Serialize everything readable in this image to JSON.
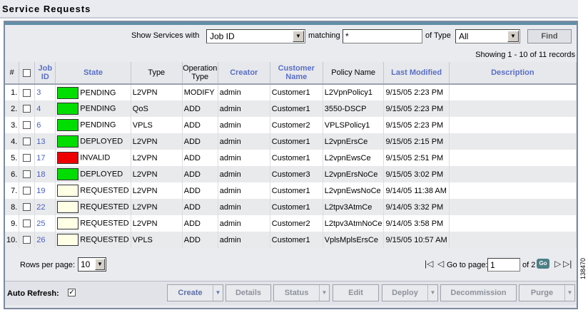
{
  "page": {
    "title": "Service Requests",
    "figure_id": "138470"
  },
  "filter": {
    "show_label": "Show Services with",
    "field_value": "Job ID",
    "matching_label": "matching",
    "matching_value": "*",
    "type_label": "of Type",
    "type_value": "All",
    "find_label": "Find"
  },
  "showing_text": "Showing 1 - 10 of 11 records",
  "table": {
    "headers": {
      "num": "#",
      "job_id": "Job ID",
      "state": "State",
      "type": "Type",
      "op_type": "Operation Type",
      "creator": "Creator",
      "customer": "Customer Name",
      "policy": "Policy Name",
      "last_modified": "Last Modified",
      "description": "Description"
    },
    "rows": [
      {
        "num": "1.",
        "job_id": "3",
        "state_color": "#00dd00",
        "state": "PENDING",
        "type": "L2VPN",
        "op_type": "MODIFY",
        "creator": "admin",
        "customer": "Customer1",
        "policy": "L2VpnPolicy1",
        "last_modified": "9/15/05 2:23 PM",
        "description": ""
      },
      {
        "num": "2.",
        "job_id": "4",
        "state_color": "#00dd00",
        "state": "PENDING",
        "type": "QoS",
        "op_type": "ADD",
        "creator": "admin",
        "customer": "Customer1",
        "policy": "3550-DSCP",
        "last_modified": "9/15/05 2:23 PM",
        "description": ""
      },
      {
        "num": "3.",
        "job_id": "6",
        "state_color": "#00dd00",
        "state": "PENDING",
        "type": "VPLS",
        "op_type": "ADD",
        "creator": "admin",
        "customer": "Customer2",
        "policy": "VPLSPolicy1",
        "last_modified": "9/15/05 2:23 PM",
        "description": ""
      },
      {
        "num": "4.",
        "job_id": "13",
        "state_color": "#00dd00",
        "state": "DEPLOYED",
        "type": "L2VPN",
        "op_type": "ADD",
        "creator": "admin",
        "customer": "Customer1",
        "policy": "L2vpnErsCe",
        "last_modified": "9/15/05 2:15 PM",
        "description": ""
      },
      {
        "num": "5.",
        "job_id": "17",
        "state_color": "#ee0000",
        "state": "INVALID",
        "type": "L2VPN",
        "op_type": "ADD",
        "creator": "admin",
        "customer": "Customer1",
        "policy": "L2vpnEwsCe",
        "last_modified": "9/15/05 2:51 PM",
        "description": ""
      },
      {
        "num": "6.",
        "job_id": "18",
        "state_color": "#00dd00",
        "state": "DEPLOYED",
        "type": "L2VPN",
        "op_type": "ADD",
        "creator": "admin",
        "customer": "Customer3",
        "policy": "L2vpnErsNoCe",
        "last_modified": "9/15/05 3:02 PM",
        "description": ""
      },
      {
        "num": "7.",
        "job_id": "19",
        "state_color": "#ffffe6",
        "state": "REQUESTED",
        "type": "L2VPN",
        "op_type": "ADD",
        "creator": "admin",
        "customer": "Customer1",
        "policy": "L2vpnEwsNoCe",
        "last_modified": "9/14/05 11:38 AM",
        "description": ""
      },
      {
        "num": "8.",
        "job_id": "22",
        "state_color": "#ffffe6",
        "state": "REQUESTED",
        "type": "L2VPN",
        "op_type": "ADD",
        "creator": "admin",
        "customer": "Customer1",
        "policy": "L2tpv3AtmCe",
        "last_modified": "9/14/05 3:32 PM",
        "description": ""
      },
      {
        "num": "9.",
        "job_id": "25",
        "state_color": "#ffffe6",
        "state": "REQUESTED",
        "type": "L2VPN",
        "op_type": "ADD",
        "creator": "admin",
        "customer": "Customer2",
        "policy": "L2tpv3AtmNoCe",
        "last_modified": "9/14/05 3:58 PM",
        "description": ""
      },
      {
        "num": "10.",
        "job_id": "26",
        "state_color": "#ffffe6",
        "state": "REQUESTED",
        "type": "VPLS",
        "op_type": "ADD",
        "creator": "admin",
        "customer": "Customer1",
        "policy": "VplsMplsErsCe",
        "last_modified": "9/15/05 10:57 AM",
        "description": ""
      }
    ]
  },
  "pager": {
    "rows_label": "Rows per page:",
    "rows_value": "10",
    "goto_label": "Go to page:",
    "page_value": "1",
    "of_label": "of 2",
    "go_label": "Go"
  },
  "bottom": {
    "auto_refresh_label": "Auto Refresh:",
    "auto_refresh_checked": "✓",
    "buttons": {
      "create": "Create",
      "details": "Details",
      "status": "Status",
      "edit": "Edit",
      "deploy": "Deploy",
      "decommission": "Decommission",
      "purge": "Purge"
    }
  }
}
